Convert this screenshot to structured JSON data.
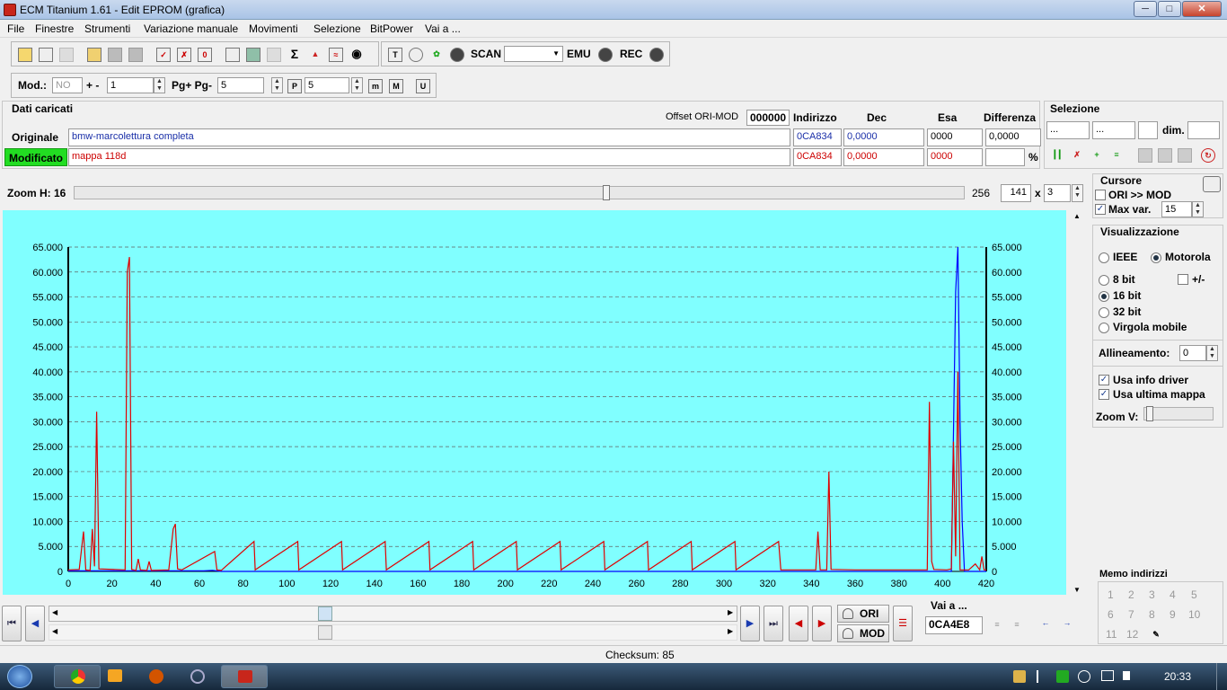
{
  "window": {
    "title": "ECM Titanium 1.61 - Edit EPROM (grafica)"
  },
  "menu": [
    "File",
    "Finestre",
    "Strumenti",
    "Variazione manuale",
    "Movimenti",
    "Selezione",
    "BitPower",
    "Vai a ..."
  ],
  "toolbar": {
    "scan": "SCAN",
    "emu": "EMU",
    "rec": "REC"
  },
  "toolbar2": {
    "mod_label": "Mod.:",
    "mod_value": "NO",
    "plusminus_label": "+ -",
    "plusminus_value": "1",
    "pg_label": "Pg+ Pg-",
    "pg_value": "5",
    "p_value": "5"
  },
  "dati": {
    "title": "Dati caricati",
    "offset_label": "Offset ORI-MOD",
    "offset_value": "000000",
    "col_indirizzo": "Indirizzo",
    "col_dec": "Dec",
    "col_esa": "Esa",
    "col_diff": "Differenza",
    "ori_label": "Originale",
    "ori_name": "bmw-marcolettura completa",
    "ori_addr": "0CA834",
    "ori_dec": "0,0000",
    "ori_esa": "0000",
    "ori_diff": "0,0000",
    "mod_label": "Modificato",
    "mod_name": "mappa 118d",
    "mod_addr": "0CA834",
    "mod_dec": "0,0000",
    "mod_esa": "0000",
    "pct": "%"
  },
  "selezione": {
    "title": "Selezione",
    "f1": "...",
    "f2": "...",
    "dim_label": "dim."
  },
  "zoom": {
    "label": "Zoom H: 16",
    "value": "256",
    "w": "141",
    "x": "x",
    "h": "3",
    "pos": 0.6
  },
  "cursore": {
    "title": "Cursore",
    "ori_mod": "ORI >> MOD",
    "maxvar_label": "Max var.",
    "maxvar_value": "15",
    "ori_mod_checked": false,
    "maxvar_checked": true
  },
  "visual": {
    "title": "Visualizzazione",
    "ieee": "IEEE",
    "motorola": "Motorola",
    "bit8": "8 bit",
    "pm": "+/-",
    "bit16": "16 bit",
    "bit32": "32 bit",
    "virgola": "Virgola mobile",
    "allineamento_label": "Allineamento:",
    "allineamento_value": "0",
    "usa_info": "Usa info driver",
    "usa_ultima": "Usa ultima mappa",
    "zoomv": "Zoom V:",
    "selected_format": "Motorola",
    "selected_bits": "16 bit"
  },
  "memo": {
    "title": "Memo indirizzi",
    "items": [
      "1",
      "2",
      "3",
      "4",
      "5",
      "6",
      "7",
      "8",
      "9",
      "10",
      "11",
      "12"
    ]
  },
  "bottom": {
    "ori": "ORI",
    "mod": "MOD",
    "vaia_label": "Vai a ...",
    "vaia_value": "0CA4E8"
  },
  "status": {
    "checksum": "Checksum: 85"
  },
  "clock": "20:33",
  "colors": {
    "chart_bg": "#80ffff",
    "ori": "#0000ff",
    "mod": "#e00000",
    "mod_green": "#22dd22"
  },
  "chart_data": {
    "type": "line",
    "xlim": [
      0,
      420
    ],
    "ylim": [
      0,
      65000
    ],
    "x_ticks": [
      0,
      20,
      40,
      60,
      80,
      100,
      120,
      140,
      160,
      180,
      200,
      220,
      240,
      260,
      280,
      300,
      320,
      340,
      360,
      380,
      400,
      420
    ],
    "y_ticks": [
      0,
      5000,
      10000,
      15000,
      20000,
      25000,
      30000,
      35000,
      40000,
      45000,
      50000,
      55000,
      60000,
      65000
    ],
    "y_tick_labels": [
      "0",
      "5.000",
      "10.000",
      "15.000",
      "20.000",
      "25.000",
      "30.000",
      "35.000",
      "40.000",
      "45.000",
      "50.000",
      "55.000",
      "60.000",
      "65.000"
    ],
    "grid": true,
    "series": [
      {
        "values": [
          [
            0,
            100
          ],
          [
            62,
            100
          ],
          [
            66,
            200
          ],
          [
            70,
            0
          ],
          [
            340,
            0
          ],
          [
            395,
            0
          ],
          [
            404,
            0
          ],
          [
            406,
            56000
          ],
          [
            407,
            65000
          ],
          [
            408,
            30000
          ],
          [
            409,
            10000
          ],
          [
            410,
            0
          ],
          [
            420,
            0
          ]
        ]
      },
      {
        "values": [
          [
            0,
            300
          ],
          [
            5,
            400
          ],
          [
            7,
            8000
          ],
          [
            8,
            300
          ],
          [
            10,
            200
          ],
          [
            11,
            8500
          ],
          [
            12,
            1000
          ],
          [
            13,
            32000
          ],
          [
            14,
            500
          ],
          [
            26,
            300
          ],
          [
            27,
            60000
          ],
          [
            28,
            63000
          ],
          [
            29,
            400
          ],
          [
            31,
            200
          ],
          [
            32,
            2500
          ],
          [
            33,
            300
          ],
          [
            36,
            200
          ],
          [
            37,
            2000
          ],
          [
            38,
            200
          ],
          [
            46,
            300
          ],
          [
            48,
            8500
          ],
          [
            49,
            9500
          ],
          [
            50,
            500
          ],
          [
            52,
            300
          ],
          [
            67,
            4000
          ],
          [
            68,
            300
          ],
          [
            70,
            200
          ],
          [
            85,
            6000
          ],
          [
            85.5,
            300
          ],
          [
            105,
            6000
          ],
          [
            105.5,
            300
          ],
          [
            125,
            6000
          ],
          [
            125.5,
            300
          ],
          [
            145,
            6000
          ],
          [
            145.5,
            300
          ],
          [
            165,
            6000
          ],
          [
            165.5,
            300
          ],
          [
            185,
            6000
          ],
          [
            185.5,
            300
          ],
          [
            205,
            6000
          ],
          [
            205.5,
            300
          ],
          [
            225,
            6000
          ],
          [
            225.5,
            300
          ],
          [
            245,
            6000
          ],
          [
            245.5,
            300
          ],
          [
            265,
            6000
          ],
          [
            265.5,
            300
          ],
          [
            285,
            6000
          ],
          [
            285.5,
            300
          ],
          [
            305,
            6000
          ],
          [
            305.5,
            300
          ],
          [
            325,
            6000
          ],
          [
            326,
            300
          ],
          [
            342,
            300
          ],
          [
            343,
            8000
          ],
          [
            344,
            300
          ],
          [
            347,
            300
          ],
          [
            348,
            20000
          ],
          [
            349,
            400
          ],
          [
            360,
            300
          ],
          [
            393,
            300
          ],
          [
            394,
            34000
          ],
          [
            395,
            2000
          ],
          [
            396,
            400
          ],
          [
            402,
            300
          ],
          [
            404,
            500
          ],
          [
            405,
            26000
          ],
          [
            406,
            3000
          ],
          [
            407,
            40000
          ],
          [
            408,
            300
          ],
          [
            412,
            300
          ],
          [
            415,
            1500
          ],
          [
            417,
            300
          ],
          [
            418,
            3000
          ],
          [
            419,
            300
          ],
          [
            420,
            300
          ]
        ]
      }
    ]
  }
}
